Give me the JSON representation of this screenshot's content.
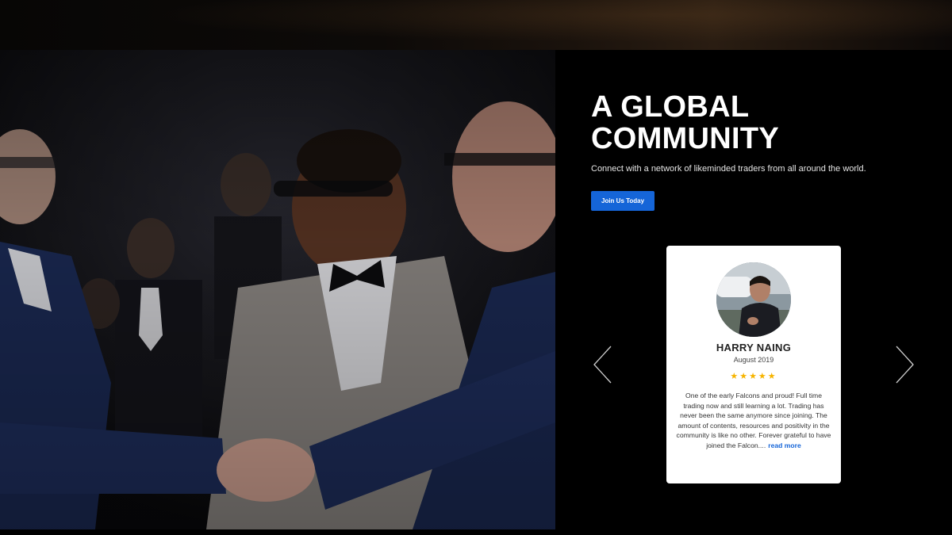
{
  "hero": {
    "title_line1": "A GLOBAL",
    "title_line2": "COMMUNITY",
    "subtitle": "Connect with a network of likeminded traders from all around the world.",
    "cta_label": "Join Us Today"
  },
  "testimonial": {
    "name": "HARRY NAING",
    "date": "August 2019",
    "stars": "★★★★★",
    "rating": 5,
    "text": "One of the early Falcons and proud! Full time trading now and still learning a lot. Trading has never been the same anymore since joining. The amount of contents, resources and positivity in the community is like no other. Forever grateful to have joined the Falcon....",
    "read_more": "read more"
  },
  "carousel": {
    "prev_icon": "chevron-left-icon",
    "next_icon": "chevron-right-icon"
  },
  "colors": {
    "accent": "#1565d8",
    "star": "#f6b400",
    "background": "#000000"
  }
}
